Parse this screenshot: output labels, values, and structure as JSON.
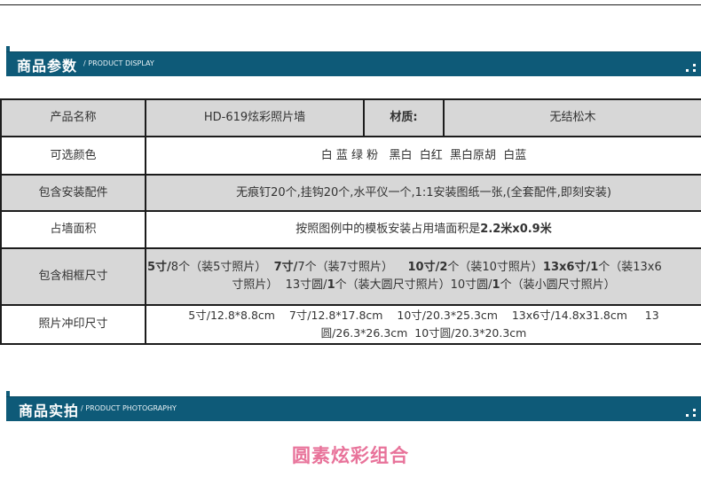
{
  "section_params": {
    "title": "商品参数",
    "subtitle": "/ PRODUCT DISPLAY"
  },
  "table": {
    "rows": [
      {
        "label": "产品名称",
        "name_value": "HD-619炫彩照片墙",
        "material_label": "材质:",
        "material_value": "无结松木"
      },
      {
        "label": "可选颜色",
        "value": "白 蓝 绿 粉   黑白  白红  黑白原胡  白蓝"
      },
      {
        "label": "包含安装配件",
        "value": "无痕钉20个,挂钩20个,水平仪一个,1:1安装图纸一张,(全套配件,即刻安装)"
      },
      {
        "label": "占墙面积",
        "value_prefix": "按照图例中的模板安装占用墙面积是",
        "value_bold": "2.2米x0.9米"
      },
      {
        "label": "包含相框尺寸",
        "line1_parts": [
          "5寸/",
          "8个（装5寸照片）  ",
          "7寸/",
          "7个（装7寸照片）    ",
          "10寸/2",
          "个（装10寸照片）",
          "13x6寸/1",
          "个（装13x6"
        ],
        "line2_parts": [
          "寸照片）  13寸圆/",
          "1",
          "个（装大圆尺寸照片）10寸圆/",
          "1",
          "个（装小圆尺寸照片）"
        ]
      },
      {
        "label": "照片冲印尺寸",
        "line1": "5寸/12.8*8.8cm    7寸/12.8*17.8cm    10寸/20.3*25.3cm    13x6寸/14.8x31.8cm     13",
        "line2": "圆/26.3*26.3cm  10寸圆/20.3*20.3cm"
      }
    ]
  },
  "section_photo": {
    "title": "商品实拍",
    "subtitle": "/ PRODUCT PHOTOGRAPHY"
  },
  "combo_title": "圆素炫彩组合",
  "colors": {
    "header_bar": "#0e5a78",
    "gray_row": "#d7d7d7",
    "combo_title": "#e8739a"
  }
}
